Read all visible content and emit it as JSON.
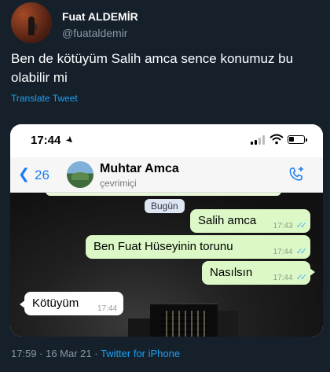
{
  "tweet": {
    "author_name": "Fuat ALDEMİR",
    "author_handle": "@fuataldemir",
    "text": "Ben de kötüyüm Salih amca sence konumuz bu olabilir mi",
    "translate_label": "Translate Tweet",
    "timestamp": "17:59 · 16 Mar 21 · ",
    "source": "Twitter for iPhone"
  },
  "phone": {
    "status_time": "17:44",
    "back_count": "26",
    "contact_name": "Muhtar Amca",
    "contact_status": "çevrimiçi",
    "date_divider": "Bugün",
    "messages": [
      {
        "direction": "out",
        "text": "Salih amca",
        "time": "17:43",
        "ticks": "✓✓"
      },
      {
        "direction": "out",
        "text": "Ben Fuat Hüseyinin torunu",
        "time": "17:44",
        "ticks": "✓✓"
      },
      {
        "direction": "out",
        "text": "Nasılsın",
        "time": "17:44",
        "ticks": "✓✓"
      },
      {
        "direction": "in",
        "text": "Kötüyüm",
        "time": "17:44"
      }
    ]
  },
  "icons": {
    "location": "location-arrow-icon",
    "signal": "cell-signal-icon",
    "wifi": "wifi-icon",
    "battery": "battery-icon",
    "back": "chevron-left-icon",
    "call": "add-call-icon"
  },
  "colors": {
    "background": "#15202b",
    "link": "#1da1f2",
    "outgoing_bubble": "#dcf8c6",
    "incoming_bubble": "#ffffff",
    "read_ticks": "#4fb6ec"
  }
}
